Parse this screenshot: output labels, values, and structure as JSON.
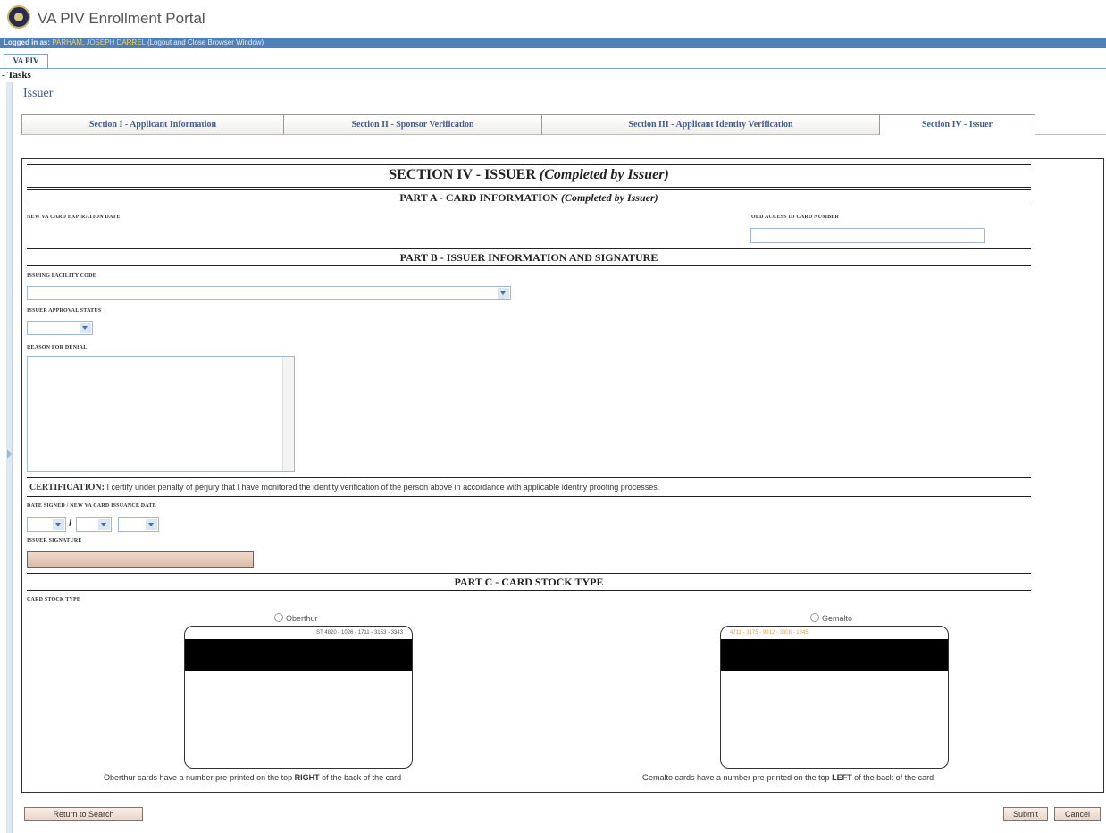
{
  "app": {
    "title": "VA PIV Enrollment Portal"
  },
  "login": {
    "prefix": "Logged in as:",
    "user": "PARHAM, JOSEPH DARREL",
    "logout": "(Logout and Close Browser Window)"
  },
  "nav": {
    "tab": "VA PIV",
    "tasks": "Tasks"
  },
  "page": {
    "title": "Issuer"
  },
  "section_tabs": [
    {
      "label": "Section I - Applicant Information"
    },
    {
      "label": "Section II - Sponsor Verification"
    },
    {
      "label": "Section III - Applicant Identity Verification"
    },
    {
      "label": "Section IV - Issuer"
    }
  ],
  "form": {
    "title": "SECTION IV - ISSUER",
    "title_note": "(Completed by Issuer)",
    "part_a": {
      "title": "PART A - CARD INFORMATION",
      "note": "(Completed by Issuer)"
    },
    "new_expiration_label": "NEW VA CARD EXPIRATION DATE",
    "old_access_label": "OLD ACCESS ID CARD NUMBER",
    "old_access_value": "",
    "part_b": {
      "title": "PART B - ISSUER INFORMATION AND SIGNATURE"
    },
    "facility_label": "ISSUING FACILITY CODE",
    "facility_value": "",
    "approval_label": "ISSUER APPROVAL STATUS",
    "approval_value": "",
    "reason_label": "REASON FOR DENIAL",
    "reason_value": "",
    "certification_label": "CERTIFICATION:",
    "certification_text": "I certify under penalty of perjury that I have monitored the identity verification of the person above in accordance with applicable identity proofing processes.",
    "date_signed_label": "DATE SIGNED / NEW VA CARD ISSUANCE DATE",
    "date_separator": "/",
    "signature_label": "ISSUER SIGNATURE",
    "part_c": {
      "title": "PART C - CARD STOCK TYPE"
    },
    "card_stock_label": "CARD STOCK TYPE",
    "options": [
      {
        "label": "Oberthur",
        "number": "ST 4820 - 1026 - 1711 - 3153 - 3343",
        "caption_pre": "Oberthur cards have a number pre-printed on the top ",
        "caption_bold": "RIGHT",
        "caption_post": " of the back of the card"
      },
      {
        "label": "Gemalto",
        "number": "4711 - 3175 - 9012 - 3308 - 1845",
        "caption_pre": "Gemalto cards have a number pre-printed on the top ",
        "caption_bold": "LEFT",
        "caption_post": " of the back of the card"
      }
    ]
  },
  "buttons": {
    "return": "Return to Search",
    "submit": "Submit",
    "cancel": "Cancel"
  },
  "colors": {
    "accent": "#4f80b8",
    "tab_text": "#3e5f8c",
    "user_name": "#f2d36a"
  }
}
